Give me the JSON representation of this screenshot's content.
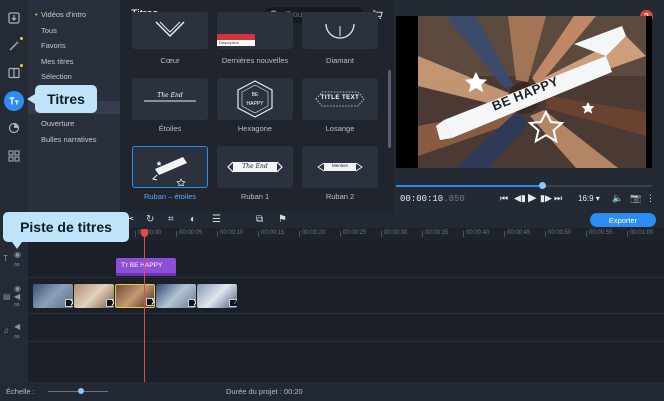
{
  "categories": [
    {
      "label": "Vidéos d'intro",
      "bullet": true
    },
    {
      "label": "Tous"
    },
    {
      "label": "Favoris"
    },
    {
      "label": "Mes titres"
    },
    {
      "label": "Sélection"
    },
    {
      "label": ""
    },
    {
      "label": ""
    },
    {
      "label": "Ouverture"
    },
    {
      "label": "Bulles narratives"
    }
  ],
  "library": {
    "title": "Titres",
    "search_placeholder": "Trouvez",
    "tiles": [
      {
        "label": "Cœur"
      },
      {
        "label": "Dernières nouvelles",
        "preview_text": "Description"
      },
      {
        "label": "Diamant"
      },
      {
        "label": "Étoiles",
        "preview_text": "The End"
      },
      {
        "label": "Hexagone",
        "preview_line1": "BE",
        "preview_line2": "HAPPY"
      },
      {
        "label": "Losange",
        "preview_text": "TITLE TEXT"
      },
      {
        "label": "Ruban – étoiles",
        "selected": true
      },
      {
        "label": "Ruban 1",
        "preview_text": "The End"
      },
      {
        "label": "Ruban 2",
        "preview_text": "Mention"
      }
    ]
  },
  "preview": {
    "overlay_text": "BE HAPPY",
    "timecode": "00:00:10",
    "timecode_ms": ".850",
    "aspect_ratio": "16:9",
    "progress": 0.57,
    "help_label": "?"
  },
  "toolbar": {
    "export_label": "Exporter"
  },
  "ruler": [
    "00:00:00",
    "00:00:05",
    "00:00:10",
    "00:00:15",
    "00:00:20",
    "00:00:25",
    "00:00:30",
    "00:00:35",
    "00:00:40",
    "00:00:45",
    "00:00:50",
    "00:00:55",
    "00:01:00"
  ],
  "timeline": {
    "title_clip_label": "BE HAPPY"
  },
  "status": {
    "scale_label": "Échelle :",
    "duration_label": "Durée du projet : 00:20",
    "scale_value": 0.55
  },
  "callouts": {
    "titres": "Titres",
    "piste": "Piste de titres"
  },
  "colors": {
    "accent": "#2d8cf0",
    "title_clip": "#8e4fd8",
    "playhead": "#e5474a",
    "callout": "#bfe4fa"
  }
}
